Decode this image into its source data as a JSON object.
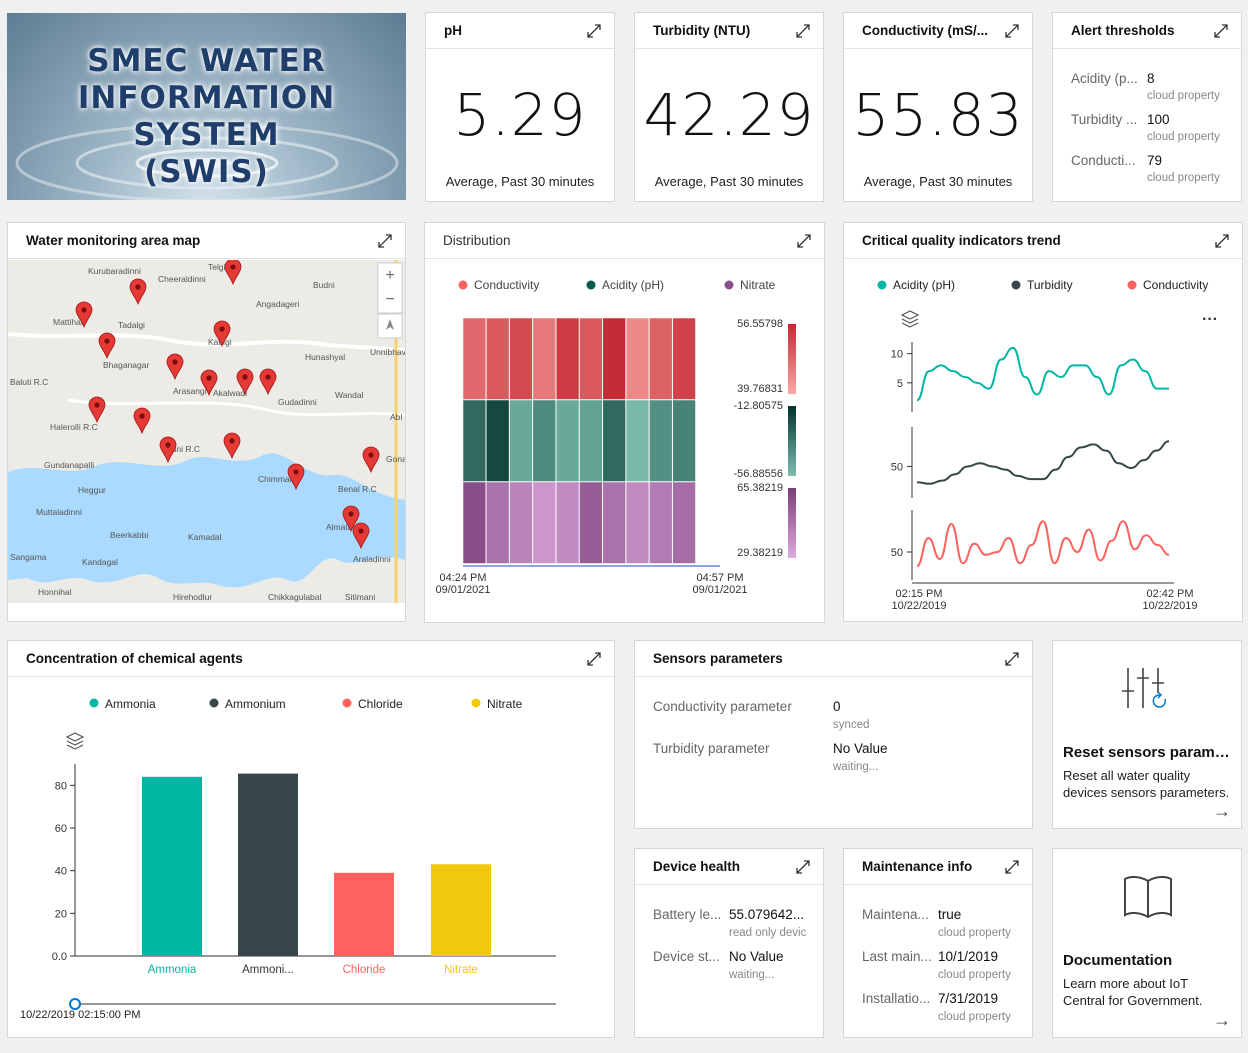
{
  "banner": {
    "line1": "SMEC WATER",
    "line2": "INFORMATION SYSTEM",
    "line3": "(SWIS)"
  },
  "kpi": {
    "ph": {
      "title": "pH",
      "value": "5.29",
      "sub": "Average, Past 30 minutes"
    },
    "turbidity": {
      "title": "Turbidity (NTU)",
      "value": "42.29",
      "sub": "Average, Past 30 minutes"
    },
    "conductivity": {
      "title": "Conductivity (mS/...",
      "value": "55.83",
      "sub": "Average, Past 30 minutes"
    }
  },
  "alerts": {
    "title": "Alert thresholds",
    "rows": [
      {
        "name": "Acidity (p...",
        "value": "8",
        "sub": "cloud property"
      },
      {
        "name": "Turbidity ...",
        "value": "100",
        "sub": "cloud property"
      },
      {
        "name": "Conducti...",
        "value": "79",
        "sub": "cloud property"
      }
    ]
  },
  "map": {
    "title": "Water monitoring area map",
    "places": [
      "Kurubaradinni",
      "Cheeraldinni",
      "Telgi",
      "Budni",
      "Angadageri",
      "Mattihal",
      "Tadalgi",
      "Kaulgi",
      "Unnibhavi",
      "Bhaganagar",
      "Hunashyal",
      "Baluti R.C",
      "Arasangi",
      "Akalwadi",
      "Wandal",
      "Halerolli R.C",
      "Gudadinni",
      "Abl",
      "Bani R.C",
      "Gona",
      "Gundanapalli",
      "Heggur",
      "Chimmalgi",
      "Benal R.C",
      "Muttaladinni",
      "Almatti",
      "Beerkabbi",
      "Kamadal",
      "Araladinni",
      "Sangama",
      "Kandagal",
      "Honnihal",
      "Hirehodlur",
      "Chikkagulabal",
      "Sitimani"
    ]
  },
  "distribution": {
    "title": "Distribution"
  },
  "trend": {
    "title": "Critical quality indicators trend"
  },
  "chemical": {
    "title": "Concentration of chemical agents",
    "slider_label": "10/22/2019 02:15:00 PM"
  },
  "sensors": {
    "title": "Sensors parameters",
    "rows": [
      {
        "name": "Conductivity parameter",
        "value": "0",
        "sub": "synced"
      },
      {
        "name": "Turbidity parameter",
        "value": "No Value",
        "sub": "waiting..."
      }
    ]
  },
  "reset": {
    "title": "Reset sensors paramet...",
    "desc": "Reset all water quality devices sensors parameters."
  },
  "health": {
    "title": "Device health",
    "rows": [
      {
        "name": "Battery le...",
        "value": "55.079642...",
        "sub": "read only devic"
      },
      {
        "name": "Device st...",
        "value": "No Value",
        "sub": "waiting..."
      }
    ]
  },
  "maintenance": {
    "title": "Maintenance info",
    "rows": [
      {
        "name": "Maintena...",
        "value": "true",
        "sub": "cloud property"
      },
      {
        "name": "Last main...",
        "value": "10/1/2019",
        "sub": "cloud property"
      },
      {
        "name": "Installatio...",
        "value": "7/31/2019",
        "sub": "cloud property"
      }
    ]
  },
  "docs": {
    "title": "Documentation",
    "desc": "Learn more about IoT Central for Government."
  },
  "colors": {
    "teal": "#00b7a3",
    "dark": "#374649",
    "red": "#fd625e",
    "yellow": "#f2c80f",
    "purple": "#8a4f8a",
    "green": "#005b4e"
  },
  "chart_data": [
    {
      "type": "heatmap",
      "title": "Distribution",
      "legend": [
        "Conductivity",
        "Acidity (pH)",
        "Nitrate"
      ],
      "x_range": [
        "04:24 PM 09/01/2021",
        "04:57 PM 09/01/2021"
      ],
      "columns": 10,
      "series": [
        {
          "name": "Conductivity",
          "range": [
            39.76831,
            56.55798
          ],
          "values": [
            48,
            50,
            52,
            46,
            54,
            50,
            56,
            44,
            49,
            53
          ]
        },
        {
          "name": "Acidity (pH)",
          "range": [
            -56.88556,
            -12.80575
          ],
          "values": [
            -30,
            -20,
            -50,
            -40,
            -50,
            -48,
            -30,
            -55,
            -42,
            -38
          ]
        },
        {
          "name": "Nitrate",
          "range": [
            29.38219,
            65.38219
          ],
          "values": [
            60,
            48,
            42,
            36,
            40,
            55,
            48,
            40,
            45,
            50
          ]
        }
      ]
    },
    {
      "type": "line",
      "title": "Critical quality indicators trend",
      "legend": [
        "Acidity (pH)",
        "Turbidity",
        "Conductivity"
      ],
      "x_range": [
        "02:15 PM 10/22/2019",
        "02:42 PM 10/22/2019"
      ],
      "series": [
        {
          "name": "Acidity (pH)",
          "ticks": [
            5,
            10
          ],
          "ylim": [
            0,
            12
          ],
          "values": [
            2,
            7,
            8,
            7,
            6,
            5,
            4,
            9,
            11,
            6,
            3,
            7,
            6,
            8,
            8,
            6,
            3,
            8,
            9,
            7,
            4,
            4
          ]
        },
        {
          "name": "Turbidity",
          "ticks": [
            50
          ],
          "ylim": [
            30,
            75
          ],
          "values": [
            40,
            39,
            41,
            45,
            50,
            52,
            50,
            48,
            44,
            42,
            42,
            48,
            56,
            62,
            64,
            60,
            52,
            49,
            54,
            60,
            66
          ]
        },
        {
          "name": "Conductivity",
          "ticks": [
            50
          ],
          "ylim": [
            30,
            80
          ],
          "values": [
            40,
            60,
            45,
            70,
            42,
            56,
            48,
            50,
            60,
            42,
            55,
            72,
            42,
            60,
            50,
            66,
            44,
            58,
            72,
            52,
            62,
            55,
            48
          ]
        }
      ]
    },
    {
      "type": "bar",
      "title": "Concentration of chemical agents",
      "categories": [
        "Ammonia",
        "Ammoni...",
        "Chloride",
        "Nitrate"
      ],
      "legend": [
        "Ammonia",
        "Ammonium",
        "Chloride",
        "Nitrate"
      ],
      "values": [
        84,
        85.5,
        39,
        43
      ],
      "ylim": [
        0,
        90
      ],
      "yticks": [
        "0.0",
        "20",
        "40",
        "60",
        "80"
      ]
    }
  ]
}
